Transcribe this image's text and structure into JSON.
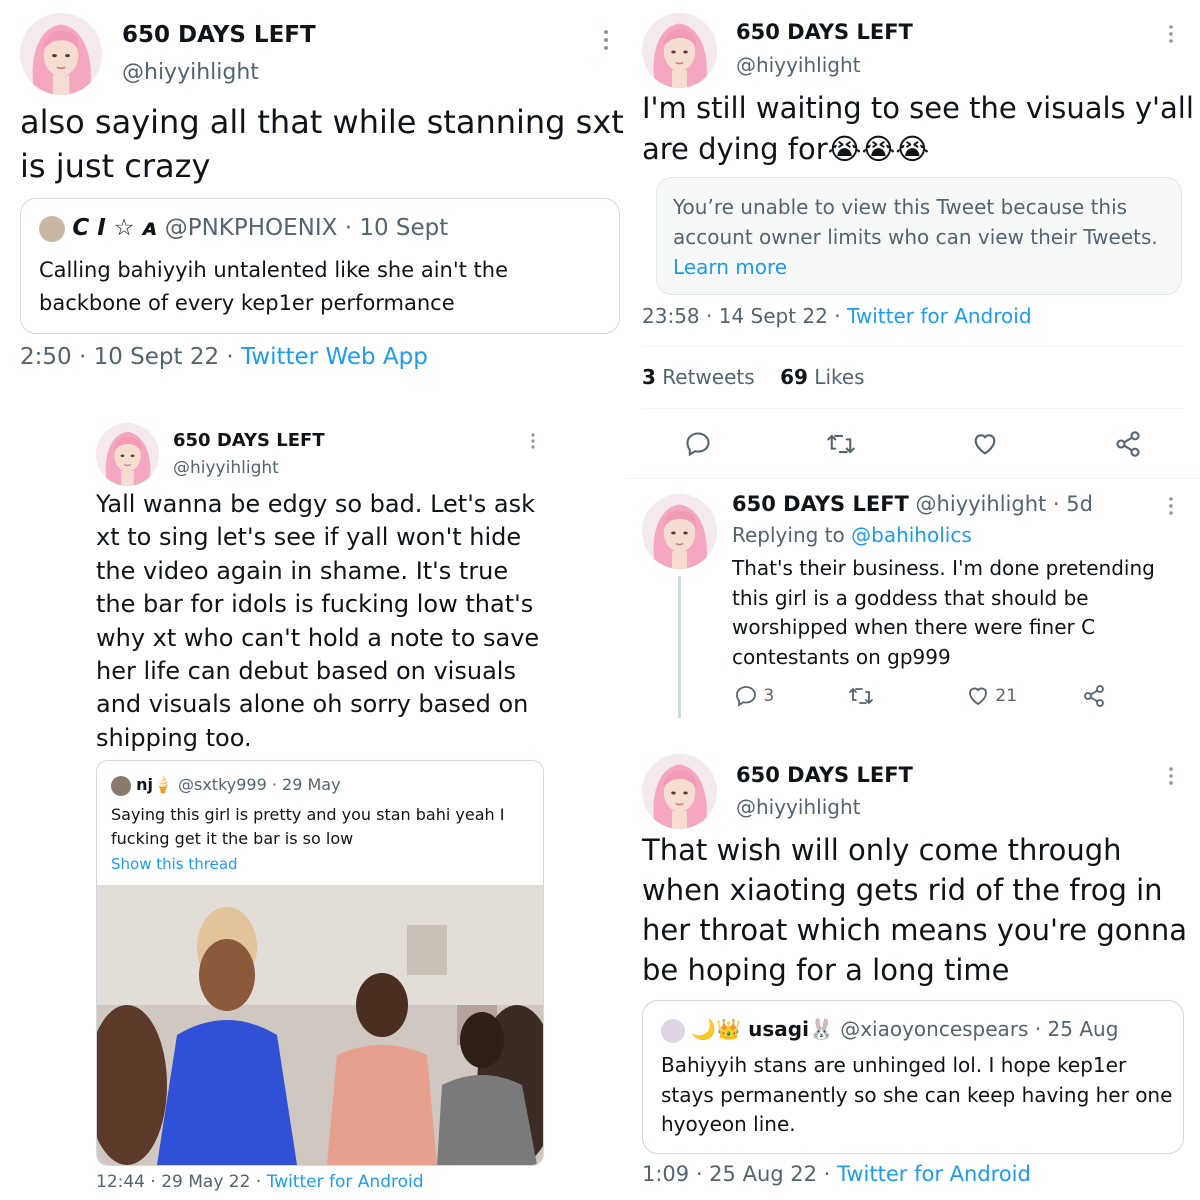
{
  "tweet1": {
    "display_name": "650 DAYS LEFT",
    "handle": "@hiyyihlight",
    "text_line1": "also saying all that while stanning sxt",
    "text_line2": "is just crazy",
    "quote": {
      "name": "C I ☆ ᴀ",
      "handle": "@PNKPHOENIX",
      "date": "· 10 Sept",
      "text_line1": "Calling bahiyyih untalented like she ain't the",
      "text_line2": "backbone of every kep1er performance"
    },
    "timestamp": "2:50 · 10 Sept 22 ·",
    "source": "Twitter Web App"
  },
  "tweet2": {
    "display_name": "650 DAYS LEFT",
    "handle": "@hiyyihlight",
    "text_lines": [
      "Yall wanna be edgy so bad. Let's ask",
      "xt to sing let's see if yall won't hide",
      "the video again in shame. It's true",
      "the bar for idols is fucking low that's",
      "why xt who can't hold a note to save",
      "her life can debut based on visuals",
      "and visuals alone oh sorry based on",
      "shipping too."
    ],
    "quote": {
      "name": "nj🍦",
      "handle": "@sxtky999",
      "date": "· 29 May",
      "text_line1": "Saying this girl is pretty and you stan bahi yeah I",
      "text_line2": "fucking get it the bar is so low",
      "show_thread": "Show this thread"
    },
    "timestamp": "12:44 · 29 May 22 ·",
    "source": "Twitter for Android"
  },
  "tweet3": {
    "display_name": "650 DAYS LEFT",
    "handle": "@hiyyihlight",
    "text_line1": "I'm still waiting to see the visuals y'all",
    "text_line2": "are dying for😭😭😭",
    "unavailable_line1": "You’re unable to view this Tweet because this",
    "unavailable_line2": "account owner limits who can view their Tweets.",
    "learn_more": "Learn more",
    "timestamp": "23:58 · 14 Sept 22 ·",
    "source": "Twitter for Android",
    "retweets_count": "3",
    "retweets_label": "Retweets",
    "likes_count": "69",
    "likes_label": "Likes"
  },
  "tweet4": {
    "display_name": "650 DAYS LEFT",
    "handle": "@hiyyihlight · 5d",
    "replying_label": "Replying to",
    "replying_handle": "@bahiholics",
    "text_lines": [
      "That's their business. I'm done pretending",
      "this girl is a goddess that should be",
      "worshipped when there were finer C",
      "contestants on gp999"
    ],
    "reply_count": "3",
    "like_count": "21"
  },
  "tweet5": {
    "display_name": "650 DAYS LEFT",
    "handle": "@hiyyihlight",
    "text_lines": [
      "That wish will only come through",
      "when xiaoting gets rid of the frog in",
      "her throat which means you're gonna",
      "be hoping for a long time"
    ],
    "quote": {
      "name": "🌙👑 usagi🐰",
      "handle": "@xiaoyoncespears",
      "date": "· 25 Aug",
      "text_lines": [
        "Bahiyyih stans are unhinged lol. I hope kep1er",
        "stays permanently so she can keep having her one",
        "hyoyeon line."
      ]
    },
    "timestamp": "1:09 · 25 Aug 22 ·",
    "source": "Twitter for Android"
  },
  "icons": {
    "more": "more-dots-icon",
    "reply": "reply-icon",
    "retweet": "retweet-icon",
    "like": "heart-icon",
    "share": "share-icon"
  },
  "colors": {
    "link": "#1d9bf0",
    "muted": "#536471",
    "border": "#cfd9de"
  }
}
